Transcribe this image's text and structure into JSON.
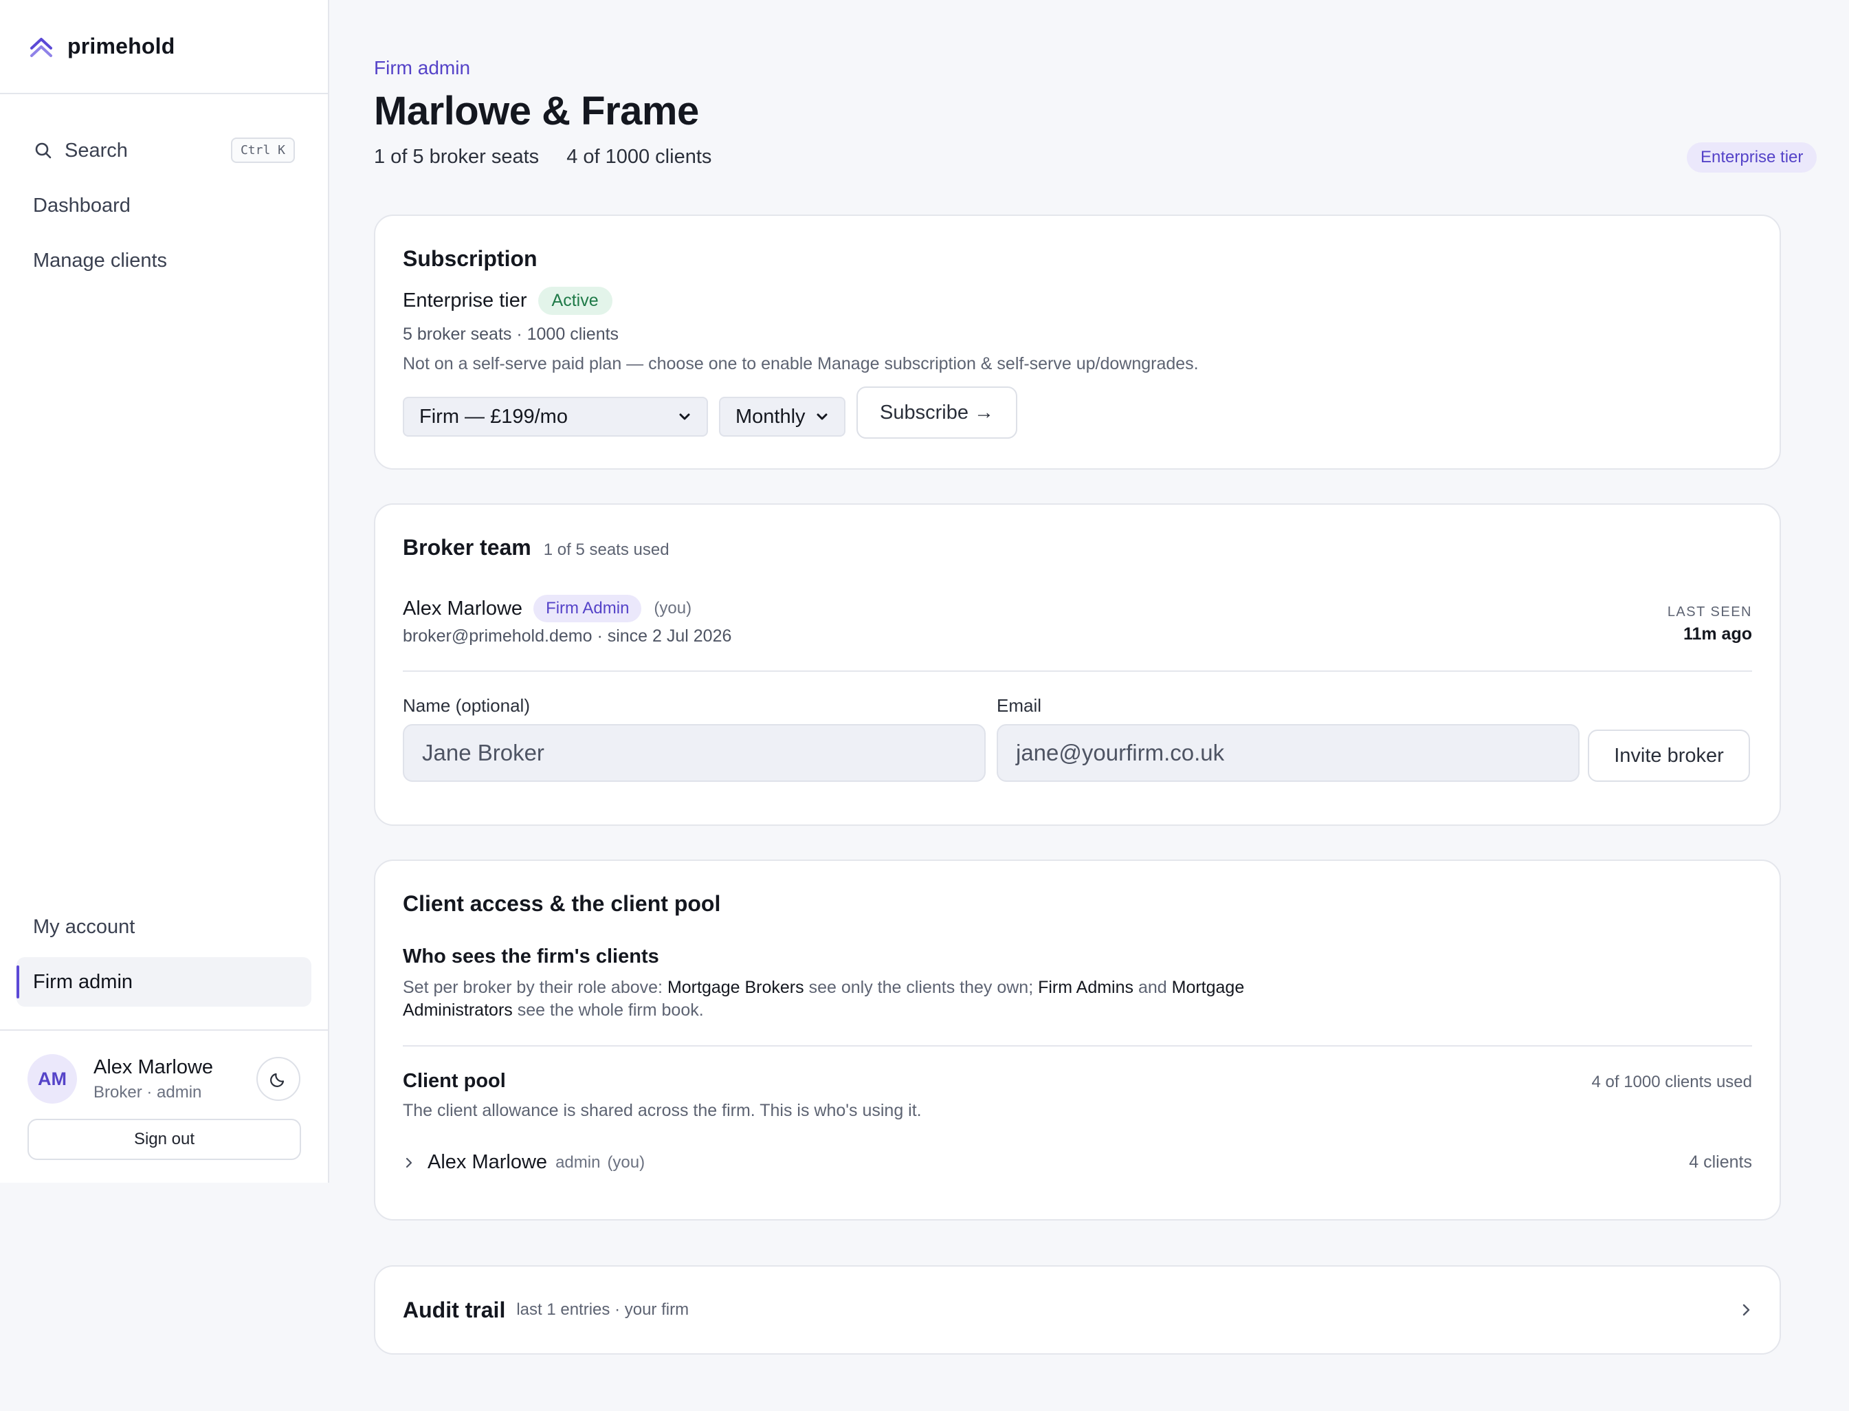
{
  "brand": {
    "name": "primehold"
  },
  "sidebar": {
    "search_label": "Search",
    "search_shortcut": "Ctrl K",
    "items": [
      {
        "label": "Dashboard"
      },
      {
        "label": "Manage clients"
      }
    ],
    "bottom_items": [
      {
        "label": "My account"
      },
      {
        "label": "Firm admin",
        "active": true
      }
    ],
    "user": {
      "initials": "AM",
      "name": "Alex Marlowe",
      "role": "Broker · admin"
    },
    "sign_out_label": "Sign out"
  },
  "header": {
    "eyebrow": "Firm admin",
    "title": "Marlowe & Frame",
    "seats": "1 of 5 broker seats",
    "clients": "4 of 1000 clients",
    "tier_badge": "Enterprise tier"
  },
  "subscription": {
    "title": "Subscription",
    "tier": "Enterprise tier",
    "status": "Active",
    "limits": "5 broker seats · 1000 clients",
    "note": "Not on a self-serve paid plan — choose one to enable Manage subscription & self-serve up/downgrades.",
    "plan_selected": "Firm — £199/mo",
    "period_selected": "Monthly",
    "subscribe_label": "Subscribe →"
  },
  "broker_team": {
    "title": "Broker team",
    "seats_used": "1 of 5 seats used",
    "members": [
      {
        "name": "Alex Marlowe",
        "role": "Firm Admin",
        "you": "(you)",
        "detail": "broker@primehold.demo · since 2 Jul 2026",
        "last_seen_label": "LAST SEEN",
        "last_seen": "11m ago"
      }
    ],
    "invite": {
      "name_label": "Name (optional)",
      "name_placeholder": "Jane Broker",
      "email_label": "Email",
      "email_placeholder": "jane@yourfirm.co.uk",
      "button_label": "Invite broker"
    }
  },
  "client_access": {
    "title": "Client access & the client pool",
    "who_title": "Who sees the firm's clients",
    "who_text": {
      "t1": "Set per broker by their role above: ",
      "k1": "Mortgage Brokers",
      "t2": " see only the clients they own; ",
      "k2": "Firm Admins",
      "t3": " and ",
      "k3": "Mortgage Administrators",
      "t4": " see the whole firm book."
    },
    "pool_title": "Client pool",
    "pool_used": "4 of 1000 clients used",
    "pool_text": "The client allowance is shared across the firm. This is who's using it.",
    "pool_rows": [
      {
        "name": "Alex Marlowe",
        "role": "admin",
        "you": "(you)",
        "count": "4 clients"
      }
    ]
  },
  "audit": {
    "title": "Audit trail",
    "subtitle": "last 1 entries · your firm"
  },
  "colors": {
    "accent": "#5543c8",
    "success": "#1f7a48",
    "background": "#f6f7fa"
  }
}
